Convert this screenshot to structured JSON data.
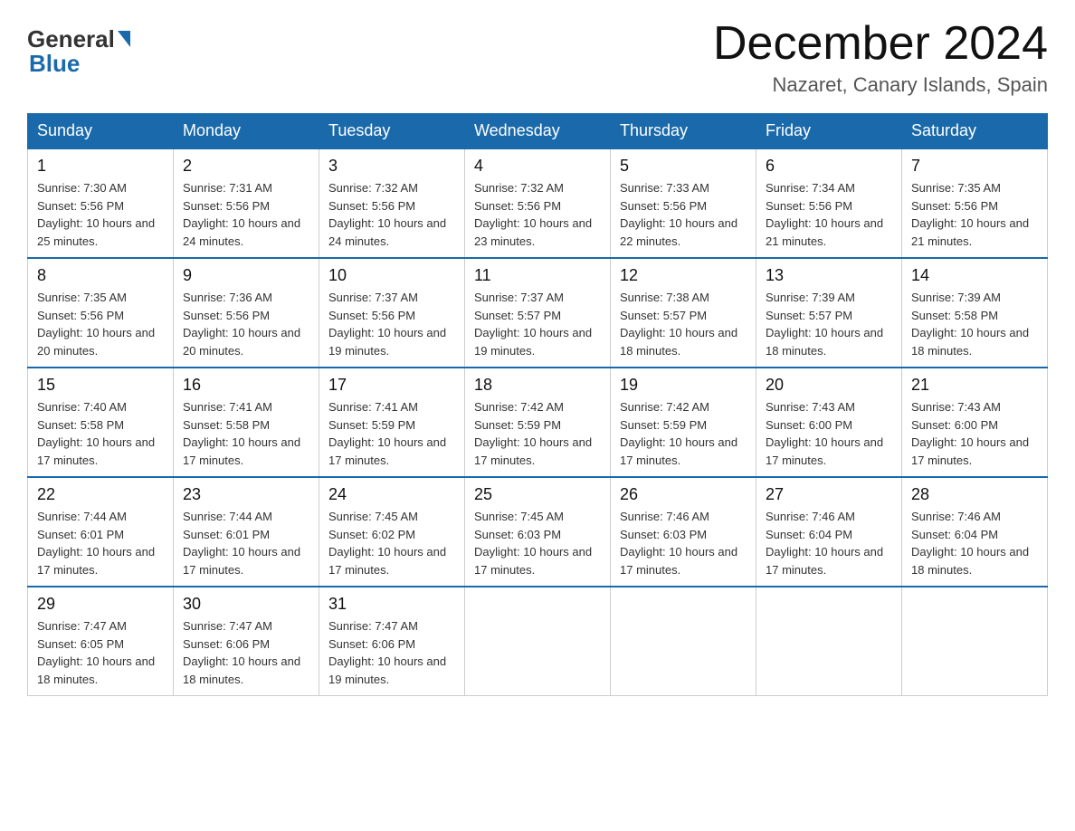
{
  "header": {
    "logo_general": "General",
    "logo_blue": "Blue",
    "month_title": "December 2024",
    "subtitle": "Nazaret, Canary Islands, Spain"
  },
  "days_of_week": [
    "Sunday",
    "Monday",
    "Tuesday",
    "Wednesday",
    "Thursday",
    "Friday",
    "Saturday"
  ],
  "weeks": [
    [
      {
        "day": "1",
        "sunrise": "7:30 AM",
        "sunset": "5:56 PM",
        "daylight": "10 hours and 25 minutes."
      },
      {
        "day": "2",
        "sunrise": "7:31 AM",
        "sunset": "5:56 PM",
        "daylight": "10 hours and 24 minutes."
      },
      {
        "day": "3",
        "sunrise": "7:32 AM",
        "sunset": "5:56 PM",
        "daylight": "10 hours and 24 minutes."
      },
      {
        "day": "4",
        "sunrise": "7:32 AM",
        "sunset": "5:56 PM",
        "daylight": "10 hours and 23 minutes."
      },
      {
        "day": "5",
        "sunrise": "7:33 AM",
        "sunset": "5:56 PM",
        "daylight": "10 hours and 22 minutes."
      },
      {
        "day": "6",
        "sunrise": "7:34 AM",
        "sunset": "5:56 PM",
        "daylight": "10 hours and 21 minutes."
      },
      {
        "day": "7",
        "sunrise": "7:35 AM",
        "sunset": "5:56 PM",
        "daylight": "10 hours and 21 minutes."
      }
    ],
    [
      {
        "day": "8",
        "sunrise": "7:35 AM",
        "sunset": "5:56 PM",
        "daylight": "10 hours and 20 minutes."
      },
      {
        "day": "9",
        "sunrise": "7:36 AM",
        "sunset": "5:56 PM",
        "daylight": "10 hours and 20 minutes."
      },
      {
        "day": "10",
        "sunrise": "7:37 AM",
        "sunset": "5:56 PM",
        "daylight": "10 hours and 19 minutes."
      },
      {
        "day": "11",
        "sunrise": "7:37 AM",
        "sunset": "5:57 PM",
        "daylight": "10 hours and 19 minutes."
      },
      {
        "day": "12",
        "sunrise": "7:38 AM",
        "sunset": "5:57 PM",
        "daylight": "10 hours and 18 minutes."
      },
      {
        "day": "13",
        "sunrise": "7:39 AM",
        "sunset": "5:57 PM",
        "daylight": "10 hours and 18 minutes."
      },
      {
        "day": "14",
        "sunrise": "7:39 AM",
        "sunset": "5:58 PM",
        "daylight": "10 hours and 18 minutes."
      }
    ],
    [
      {
        "day": "15",
        "sunrise": "7:40 AM",
        "sunset": "5:58 PM",
        "daylight": "10 hours and 17 minutes."
      },
      {
        "day": "16",
        "sunrise": "7:41 AM",
        "sunset": "5:58 PM",
        "daylight": "10 hours and 17 minutes."
      },
      {
        "day": "17",
        "sunrise": "7:41 AM",
        "sunset": "5:59 PM",
        "daylight": "10 hours and 17 minutes."
      },
      {
        "day": "18",
        "sunrise": "7:42 AM",
        "sunset": "5:59 PM",
        "daylight": "10 hours and 17 minutes."
      },
      {
        "day": "19",
        "sunrise": "7:42 AM",
        "sunset": "5:59 PM",
        "daylight": "10 hours and 17 minutes."
      },
      {
        "day": "20",
        "sunrise": "7:43 AM",
        "sunset": "6:00 PM",
        "daylight": "10 hours and 17 minutes."
      },
      {
        "day": "21",
        "sunrise": "7:43 AM",
        "sunset": "6:00 PM",
        "daylight": "10 hours and 17 minutes."
      }
    ],
    [
      {
        "day": "22",
        "sunrise": "7:44 AM",
        "sunset": "6:01 PM",
        "daylight": "10 hours and 17 minutes."
      },
      {
        "day": "23",
        "sunrise": "7:44 AM",
        "sunset": "6:01 PM",
        "daylight": "10 hours and 17 minutes."
      },
      {
        "day": "24",
        "sunrise": "7:45 AM",
        "sunset": "6:02 PM",
        "daylight": "10 hours and 17 minutes."
      },
      {
        "day": "25",
        "sunrise": "7:45 AM",
        "sunset": "6:03 PM",
        "daylight": "10 hours and 17 minutes."
      },
      {
        "day": "26",
        "sunrise": "7:46 AM",
        "sunset": "6:03 PM",
        "daylight": "10 hours and 17 minutes."
      },
      {
        "day": "27",
        "sunrise": "7:46 AM",
        "sunset": "6:04 PM",
        "daylight": "10 hours and 17 minutes."
      },
      {
        "day": "28",
        "sunrise": "7:46 AM",
        "sunset": "6:04 PM",
        "daylight": "10 hours and 18 minutes."
      }
    ],
    [
      {
        "day": "29",
        "sunrise": "7:47 AM",
        "sunset": "6:05 PM",
        "daylight": "10 hours and 18 minutes."
      },
      {
        "day": "30",
        "sunrise": "7:47 AM",
        "sunset": "6:06 PM",
        "daylight": "10 hours and 18 minutes."
      },
      {
        "day": "31",
        "sunrise": "7:47 AM",
        "sunset": "6:06 PM",
        "daylight": "10 hours and 19 minutes."
      },
      null,
      null,
      null,
      null
    ]
  ]
}
